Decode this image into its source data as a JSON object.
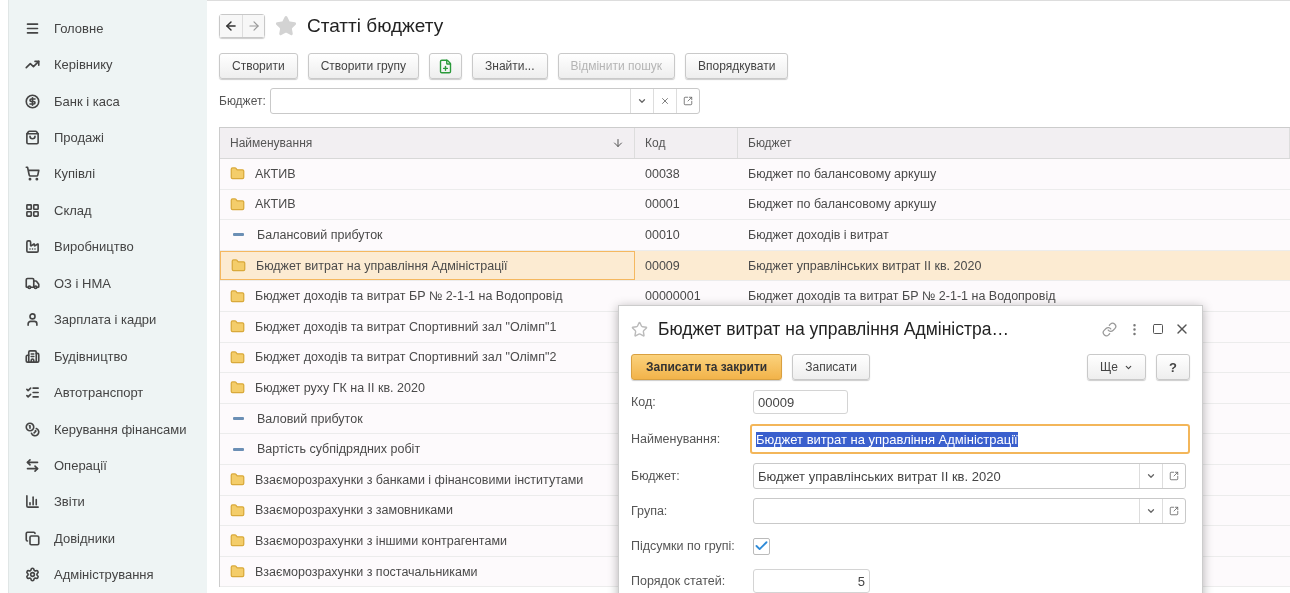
{
  "sidebar": {
    "items": [
      {
        "label": "Головне"
      },
      {
        "label": "Керівнику"
      },
      {
        "label": "Банк і каса"
      },
      {
        "label": "Продажі"
      },
      {
        "label": "Купівлі"
      },
      {
        "label": "Склад"
      },
      {
        "label": "Виробництво"
      },
      {
        "label": "ОЗ і НМА"
      },
      {
        "label": "Зарплата і кадри"
      },
      {
        "label": "Будівництво"
      },
      {
        "label": "Автотранспорт"
      },
      {
        "label": "Керування фінансами"
      },
      {
        "label": "Операції"
      },
      {
        "label": "Звіти"
      },
      {
        "label": "Довідники"
      },
      {
        "label": "Адміністрування"
      }
    ]
  },
  "window": {
    "title": "Статті бюджету"
  },
  "toolbar": {
    "buttons": [
      {
        "kind": "text",
        "label": "Створити",
        "disabled": false
      },
      {
        "kind": "text",
        "label": "Створити групу",
        "disabled": false
      },
      {
        "kind": "icon",
        "disabled": false
      },
      {
        "kind": "text",
        "label": "Знайти...",
        "disabled": false
      },
      {
        "kind": "text",
        "label": "Відмінити пошук",
        "disabled": true
      },
      {
        "kind": "text",
        "label": "Впорядкувати",
        "disabled": false
      }
    ]
  },
  "filter": {
    "label": "Бюджет:"
  },
  "table": {
    "columns": [
      "Найменування",
      "Код",
      "Бюджет"
    ],
    "rows": [
      {
        "kind": "group",
        "name": "АКТИВ",
        "code": "00038",
        "budget": "Бюджет по балансовому аркушу",
        "selected": false
      },
      {
        "kind": "group",
        "name": "АКТИВ",
        "code": "00001",
        "budget": "Бюджет по балансовому аркушу",
        "selected": false
      },
      {
        "kind": "item",
        "name": "Балансовий прибуток",
        "code": "00010",
        "budget": "Бюджет доходів і витрат",
        "selected": false
      },
      {
        "kind": "group",
        "name": "Бюджет витрат на управління Адміністрації",
        "code": "00009",
        "budget": "Бюджет управлінських витрат ІІ кв. 2020",
        "selected": true
      },
      {
        "kind": "group",
        "name": "Бюджет доходів та витрат БР № 2-1-1 на Водопровід",
        "code": "00000001",
        "budget": "Бюджет доходів та витрат БР № 2-1-1 на Водопровід",
        "selected": false
      },
      {
        "kind": "group",
        "name": "Бюджет доходів та витрат Спортивний зал \"Олімп\"1",
        "selected": false
      },
      {
        "kind": "group",
        "name": "Бюджет доходів та витрат Спортивний зал \"Олімп\"2",
        "selected": false
      },
      {
        "kind": "group",
        "name": "Бюджет руху ГК на ІІ кв. 2020",
        "selected": false
      },
      {
        "kind": "item",
        "name": "Валовий прибуток",
        "selected": false
      },
      {
        "kind": "item",
        "name": "Вартість субпідрядних робіт",
        "selected": false
      },
      {
        "kind": "group",
        "name": "Взаєморозрахунки з банками і фінансовими інститутами",
        "selected": false
      },
      {
        "kind": "group",
        "name": "Взаєморозрахунки з замовниками",
        "selected": false
      },
      {
        "kind": "group",
        "name": "Взаєморозрахунки з іншими контрагентами",
        "selected": false
      },
      {
        "kind": "group",
        "name": "Взаєморозрахунки з постачальниками",
        "selected": false
      }
    ]
  },
  "dialog": {
    "title": "Бюджет витрат на управління Адміністра…",
    "buttons": [
      {
        "label": "Записати та закрити",
        "kind": "primary"
      },
      {
        "label": "Записати",
        "kind": "plain"
      }
    ],
    "more": "Ще",
    "help": "?",
    "fields": [
      {
        "kind": "short",
        "label": "Код:",
        "value": "00009"
      },
      {
        "kind": "focused",
        "label": "Найменування:",
        "value": "Бюджет витрат на управління Адміністрації"
      },
      {
        "kind": "select",
        "label": "Бюджет:",
        "value": "Бюджет управлінських витрат ІІ кв. 2020"
      },
      {
        "kind": "select",
        "label": "Група:"
      },
      {
        "kind": "checkbox",
        "label": "Підсумки по групі:",
        "checked": true
      },
      {
        "kind": "number",
        "label": "Порядок статей:",
        "value": "5"
      }
    ]
  }
}
